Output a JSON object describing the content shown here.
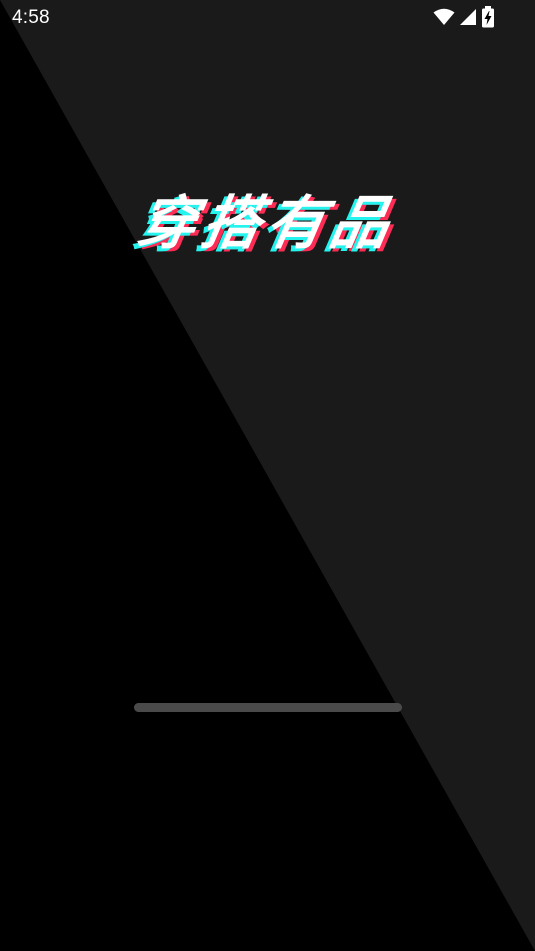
{
  "status_bar": {
    "time": "4:58",
    "icons": [
      "wifi-icon",
      "cellular-signal-icon",
      "battery-charging-icon"
    ]
  },
  "splash": {
    "title": "穿搭有品",
    "title_colors": {
      "main": "#ffffff",
      "shadow_cyan": "#25f4ee",
      "shadow_red": "#fe2c55"
    }
  },
  "loader": {
    "progress": 1.0,
    "color": "#4a4a4a"
  },
  "background": {
    "dark": "#000000",
    "light": "#1a1a1a"
  }
}
